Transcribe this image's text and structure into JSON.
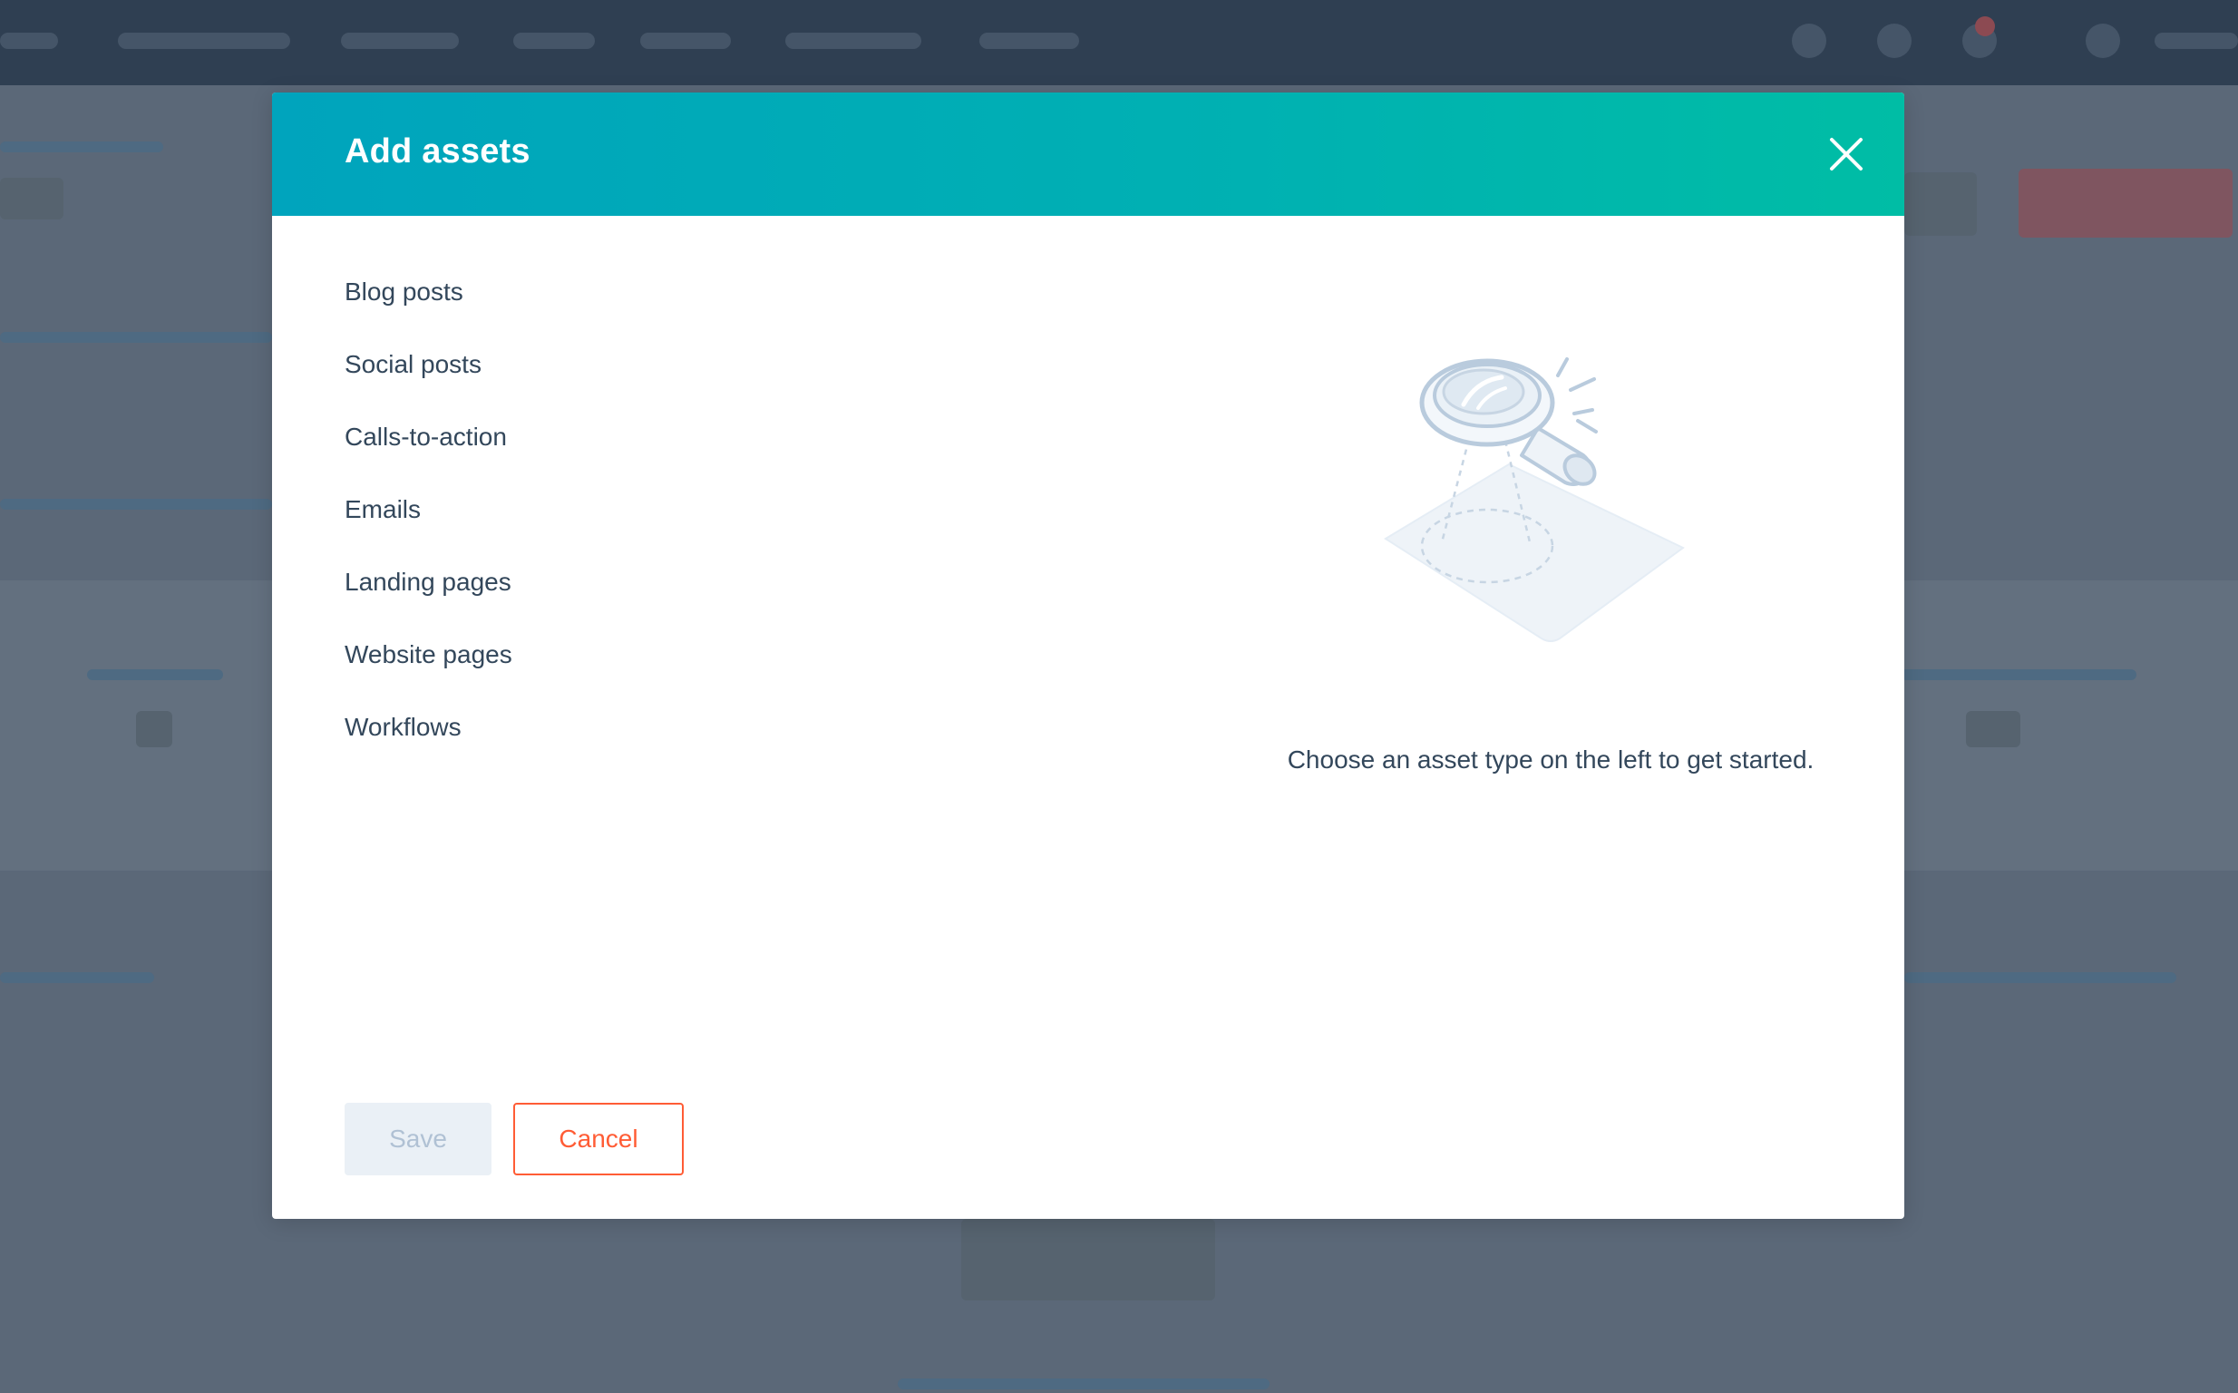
{
  "modal": {
    "title": "Add assets",
    "asset_types": [
      "Blog posts",
      "Social posts",
      "Calls-to-action",
      "Emails",
      "Landing pages",
      "Website pages",
      "Workflows"
    ],
    "empty_state_text": "Choose an asset type on the left to get started.",
    "buttons": {
      "save": "Save",
      "cancel": "Cancel"
    },
    "icons": {
      "close": "close-icon",
      "illustration": "magnifying-glass-illustration"
    }
  },
  "colors": {
    "header_gradient_start": "#00a4bd",
    "header_gradient_end": "#00bda5",
    "text": "#33475b",
    "cancel_accent": "#ff5c35",
    "save_disabled_bg": "#eaf0f6",
    "save_disabled_text": "#b0c1d4",
    "overlay": "#5d6b7b"
  }
}
